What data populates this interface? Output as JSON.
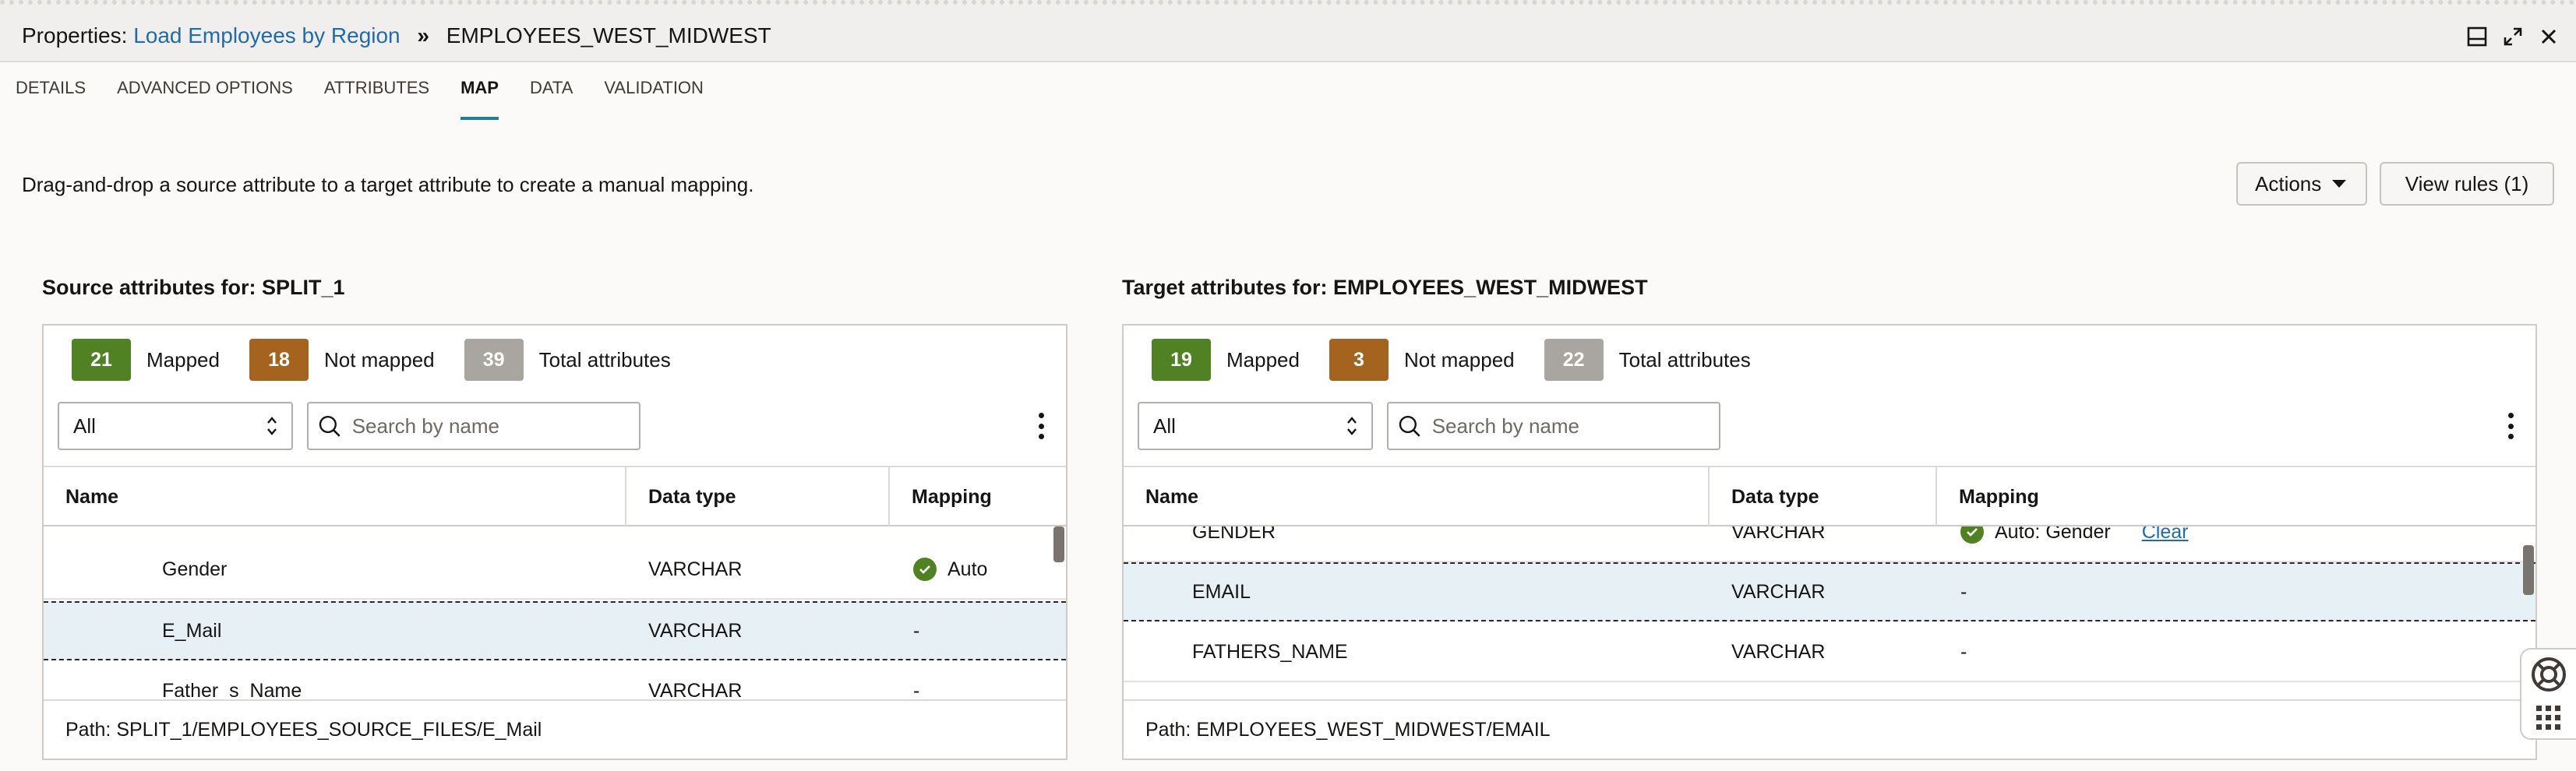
{
  "header": {
    "prefix": "Properties:",
    "link": "Load Employees by Region",
    "separator": "»",
    "target": "EMPLOYEES_WEST_MIDWEST"
  },
  "tabs": [
    "DETAILS",
    "ADVANCED OPTIONS",
    "ATTRIBUTES",
    "MAP",
    "DATA",
    "VALIDATION"
  ],
  "active_tab": "MAP",
  "instruction": "Drag-and-drop a source attribute to a target attribute to create a manual mapping.",
  "actions_label": "Actions",
  "view_rules_label": "View rules (1)",
  "colors": {
    "mapped": "#508223",
    "not_mapped": "#a4641f",
    "total": "#a9a6a2",
    "accent": "#227e9e",
    "link": "#1f6bab"
  },
  "source": {
    "title": "Source attributes for: SPLIT_1",
    "mapped_count": "21",
    "mapped_label": "Mapped",
    "not_mapped_count": "18",
    "not_mapped_label": "Not mapped",
    "total_count": "39",
    "total_label": "Total attributes",
    "filter": "All",
    "search_placeholder": "Search by name",
    "columns": [
      "Name",
      "Data type",
      "Mapping"
    ],
    "rows": [
      {
        "name": "Gender",
        "type": "VARCHAR",
        "mapping": "Auto"
      },
      {
        "name": "E_Mail",
        "type": "VARCHAR",
        "mapping": "-"
      },
      {
        "name": "Father_s_Name",
        "type": "VARCHAR",
        "mapping": "-"
      }
    ],
    "path": "Path: SPLIT_1/EMPLOYEES_SOURCE_FILES/E_Mail"
  },
  "target": {
    "title": "Target attributes for: EMPLOYEES_WEST_MIDWEST",
    "mapped_count": "19",
    "mapped_label": "Mapped",
    "not_mapped_count": "3",
    "not_mapped_label": "Not mapped",
    "total_count": "22",
    "total_label": "Total attributes",
    "filter": "All",
    "search_placeholder": "Search by name",
    "columns": [
      "Name",
      "Data type",
      "Mapping"
    ],
    "rows": [
      {
        "name": "GENDER",
        "type": "VARCHAR",
        "mapping": "Auto: Gender",
        "clear": "Clear"
      },
      {
        "name": "EMAIL",
        "type": "VARCHAR",
        "mapping": "-"
      },
      {
        "name": "FATHERS_NAME",
        "type": "VARCHAR",
        "mapping": "-"
      }
    ],
    "path": "Path: EMPLOYEES_WEST_MIDWEST/EMAIL"
  }
}
